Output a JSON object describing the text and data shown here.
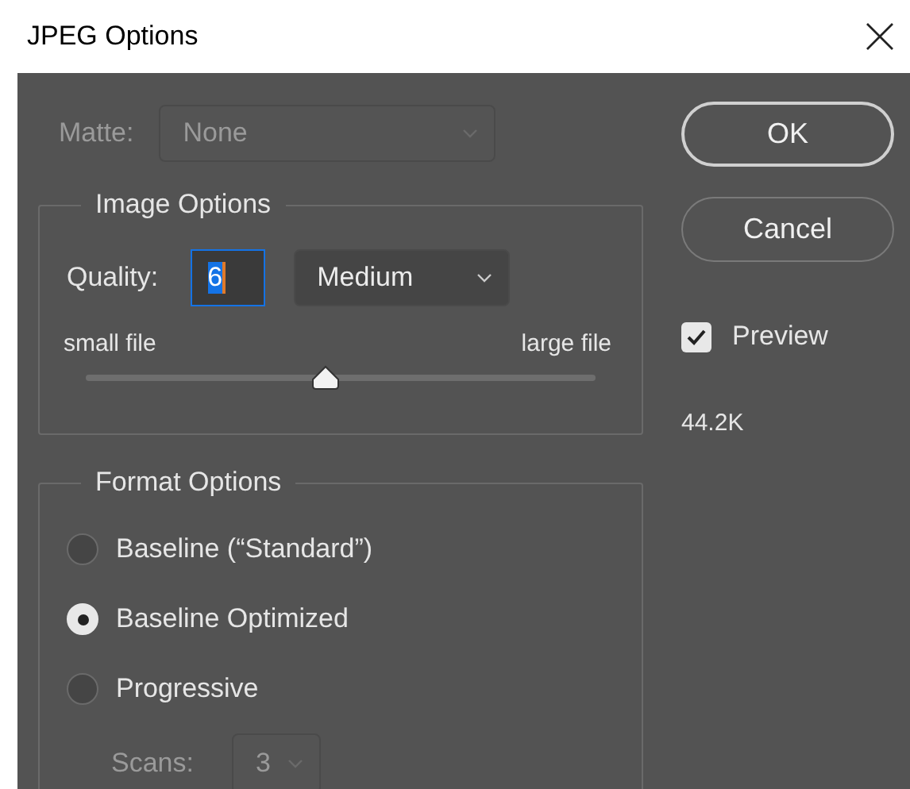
{
  "window": {
    "title": "JPEG Options"
  },
  "matte": {
    "label": "Matte:",
    "value": "None",
    "disabled": true
  },
  "image_options": {
    "title": "Image Options",
    "quality_label": "Quality:",
    "quality_value": "6",
    "quality_focused": true,
    "preset": "Medium",
    "slider": {
      "min_label": "small file",
      "max_label": "large file",
      "level": 0.47
    }
  },
  "format_options": {
    "title": "Format Options",
    "options": [
      {
        "label": "Baseline (“Standard”)",
        "selected": false
      },
      {
        "label": "Baseline Optimized",
        "selected": true
      },
      {
        "label": "Progressive",
        "selected": false
      }
    ],
    "scans": {
      "label": "Scans:",
      "value": "3",
      "disabled": true
    }
  },
  "buttons": [
    {
      "label": "OK",
      "default": true
    },
    {
      "label": "Cancel",
      "default": false
    }
  ],
  "preview": {
    "label": "Preview",
    "checked": true
  },
  "file_size": "44.2K"
}
